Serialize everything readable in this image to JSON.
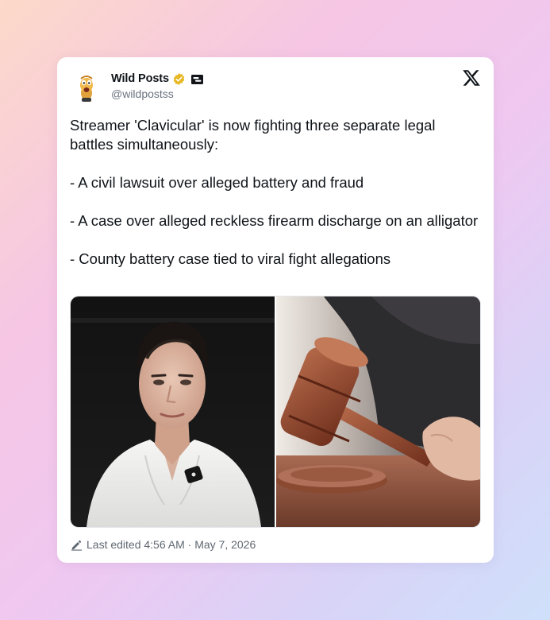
{
  "author": {
    "display_name": "Wild Posts",
    "handle": "@wildpostss",
    "avatar_icon": "cartoon-character-avatar",
    "verified_icon": "verified-badge-icon",
    "affiliate_icon": "affiliate-badge-icon",
    "verified_color": "#e8b824"
  },
  "platform": {
    "logo_icon": "x-logo-icon"
  },
  "post": {
    "text": "Streamer 'Clavicular' is now fighting three separate legal battles simultaneously:\n\n- A civil lawsuit over alleged battery and fraud\n\n- A case over alleged reckless firearm discharge on an alligator\n\n- County battery case tied to viral fight allegations"
  },
  "media": [
    {
      "subject": "young man with slicked-back dark hair in white open-collar shirt with clip-on microphone"
    },
    {
      "subject": "hand holding a wooden judge's gavel over a sound block"
    }
  ],
  "footer": {
    "edit_icon": "pencil-icon",
    "edited_text": "Last edited 4:56 AM · May 7, 2026"
  },
  "colors": {
    "text_primary": "#0f1419",
    "text_secondary": "#6b7480"
  }
}
